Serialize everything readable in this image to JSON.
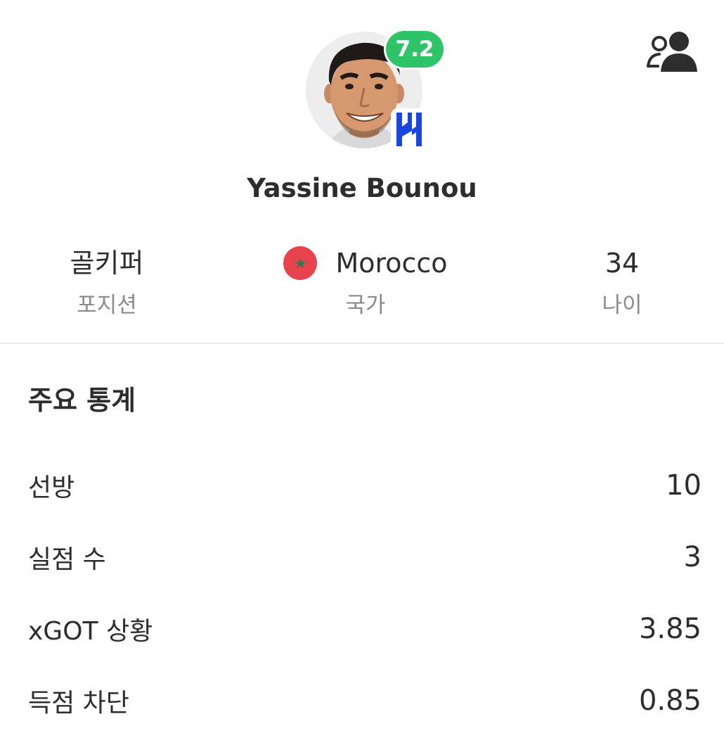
{
  "player": {
    "name": "Yassine Bounou",
    "rating": "7.2",
    "rating_color": "#2fc46a",
    "avatar_icon": "player-photo",
    "club_logo_icon": "al-hilal-logo",
    "club_color": "#1a46e0"
  },
  "header": {
    "profile_icon": "people-icon"
  },
  "info": {
    "position_value": "골키퍼",
    "position_label": "포지션",
    "country_value": "Morocco",
    "country_label": "국가",
    "country_flag_icon": "morocco-flag",
    "age_value": "34",
    "age_label": "나이"
  },
  "stats": {
    "title": "주요 통계",
    "rows": [
      {
        "label": "선방",
        "value": "10"
      },
      {
        "label": "실점 수",
        "value": "3"
      },
      {
        "label": "xGOT 상황",
        "value": "3.85"
      },
      {
        "label": "득점 차단",
        "value": "0.85"
      }
    ]
  }
}
